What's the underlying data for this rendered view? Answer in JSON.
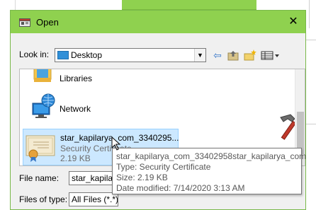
{
  "dialog": {
    "title": "Open",
    "close_glyph": "✕",
    "accent": "#8fd14f"
  },
  "toolbar": {
    "lookin_label": "Look in:",
    "lookin_value": "Desktop",
    "icons": [
      "back-arrow-icon",
      "up-folder-icon",
      "new-folder-icon",
      "view-menu-icon"
    ]
  },
  "items": [
    {
      "label": "Libraries",
      "icon": "libraries-icon"
    },
    {
      "label": "Network",
      "icon": "network-icon"
    },
    {
      "name": "star_kapilarya_com_3340295...",
      "type": "Security Certificate",
      "size": "2.19 KB",
      "icon": "certificate-icon"
    }
  ],
  "filename": {
    "label": "File name:",
    "value": "star_kapilarya"
  },
  "filetype": {
    "label": "Files of type:",
    "value": "All Files (*.*)"
  },
  "tooltip": {
    "line1": "star_kapilarya_com_33402958star_kapilarya_com",
    "line2": "Type: Security Certificate",
    "line3": "Size: 2.19 KB",
    "line4": "Date modified: 7/14/2020 3:13 AM"
  }
}
